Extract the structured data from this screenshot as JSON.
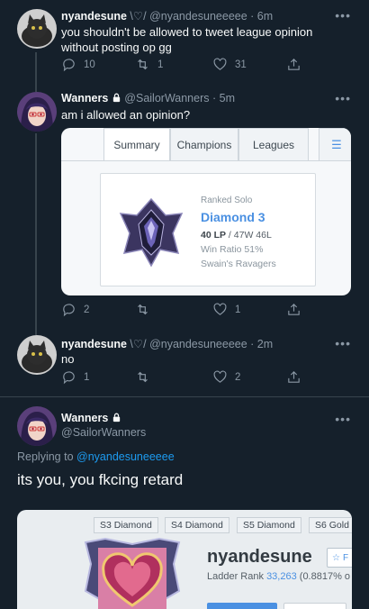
{
  "tweets": [
    {
      "display_name": "nyandesune",
      "name_decor": "\\♡/",
      "handle": "@nyandesuneeeee",
      "time": "· 6m",
      "text": "you shouldn't be allowed to tweet league opinion without posting op gg",
      "replies": "10",
      "retweets": "1",
      "likes": "31"
    },
    {
      "display_name": "Wanners",
      "handle": "@SailorWanners",
      "time": "· 5m",
      "text": "am i allowed an opinion?",
      "replies": "2",
      "retweets": "",
      "likes": "1"
    },
    {
      "display_name": "nyandesune",
      "name_decor": "\\♡/",
      "handle": "@nyandesuneeeee",
      "time": "· 2m",
      "text": "no",
      "replies": "1",
      "retweets": "",
      "likes": "2"
    }
  ],
  "focused": {
    "display_name": "Wanners",
    "handle": "@SailorWanners",
    "replying_prefix": "Replying to",
    "replying_to": "@nyandesuneeeee",
    "text": "its you, you fkcing retard"
  },
  "opgg_card": {
    "tabs": [
      "Summary",
      "Champions",
      "Leagues"
    ],
    "queue": "Ranked Solo",
    "tier": "Diamond 3",
    "lp": "40 LP",
    "record": " / 47W 46L",
    "win_ratio": "Win Ratio 51%",
    "league_name": "Swain's Ravagers"
  },
  "profile_card": {
    "seasons": [
      "S3 Diamond",
      "S4 Diamond",
      "S5 Diamond",
      "S6 Gold"
    ],
    "summoner": "nyandesune",
    "ladder_prefix": "Ladder Rank",
    "ladder_rank": "33,263",
    "ladder_pct": "(0.8817% o",
    "fav_label": "F"
  },
  "more_glyph": "•••",
  "colors": {
    "background": "#15202b",
    "link": "#1d9bf0",
    "muted": "#8b98a5",
    "opgg_blue": "#4a90e2"
  }
}
